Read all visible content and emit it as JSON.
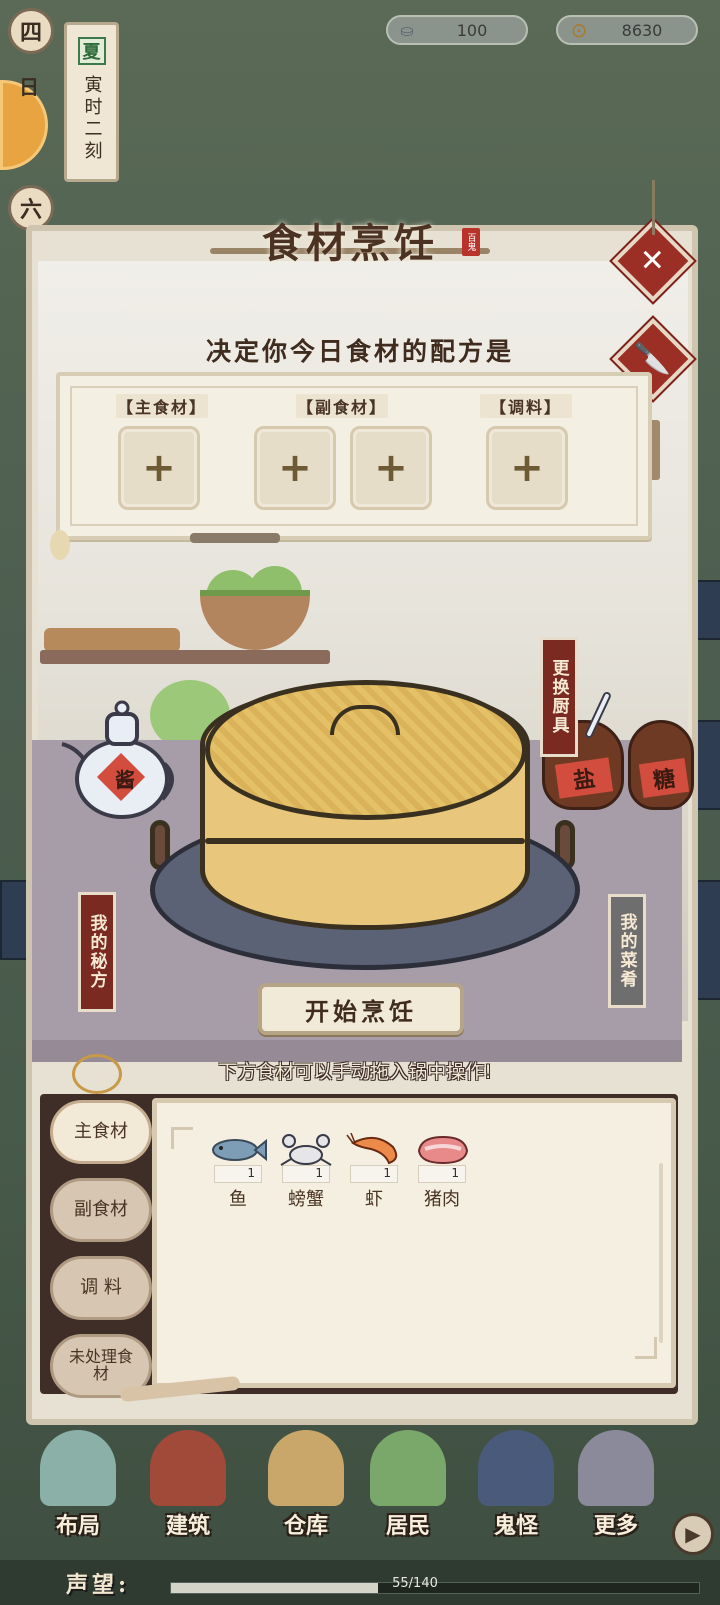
{
  "top": {
    "silver": "100",
    "coins": "8630",
    "days": [
      "四",
      "日",
      "六"
    ],
    "season": "夏",
    "time": "寅时二刻"
  },
  "panel": {
    "title": "食材烹饪",
    "stamp": "百鬼",
    "question": "决定你今日食材的配方是",
    "slots": {
      "main_label": "【主食材】",
      "side_label": "【副食材】",
      "season_label": "【调料】",
      "add_symbol": "+"
    },
    "change_tools": "更换厨具",
    "my_recipes": "我的秘方",
    "my_dishes": "我的菜肴",
    "jar_salt": "盐",
    "jar_sugar": "糖",
    "teapot_label": "酱",
    "start_button": "开始烹饪",
    "hint": "下方食材可以手动拖入锅中操作!"
  },
  "inventory": {
    "tabs": [
      "主食材",
      "副食材",
      "调 料",
      "未处理食材"
    ],
    "active_tab": 0,
    "items": [
      {
        "name": "鱼",
        "count": "1",
        "icon": "fish-icon"
      },
      {
        "name": "螃蟹",
        "count": "1",
        "icon": "crab-icon"
      },
      {
        "name": "虾",
        "count": "1",
        "icon": "shrimp-icon"
      },
      {
        "name": "猪肉",
        "count": "1",
        "icon": "pork-icon"
      }
    ]
  },
  "nav": {
    "items": [
      "布局",
      "建筑",
      "仓库",
      "居民",
      "鬼怪",
      "更多"
    ]
  },
  "reputation": {
    "label": "声望:",
    "text": "55/140",
    "value": 55,
    "max": 140
  },
  "colors": {
    "accent_red": "#9b2f25",
    "panel_bg": "#e6e1d3"
  }
}
